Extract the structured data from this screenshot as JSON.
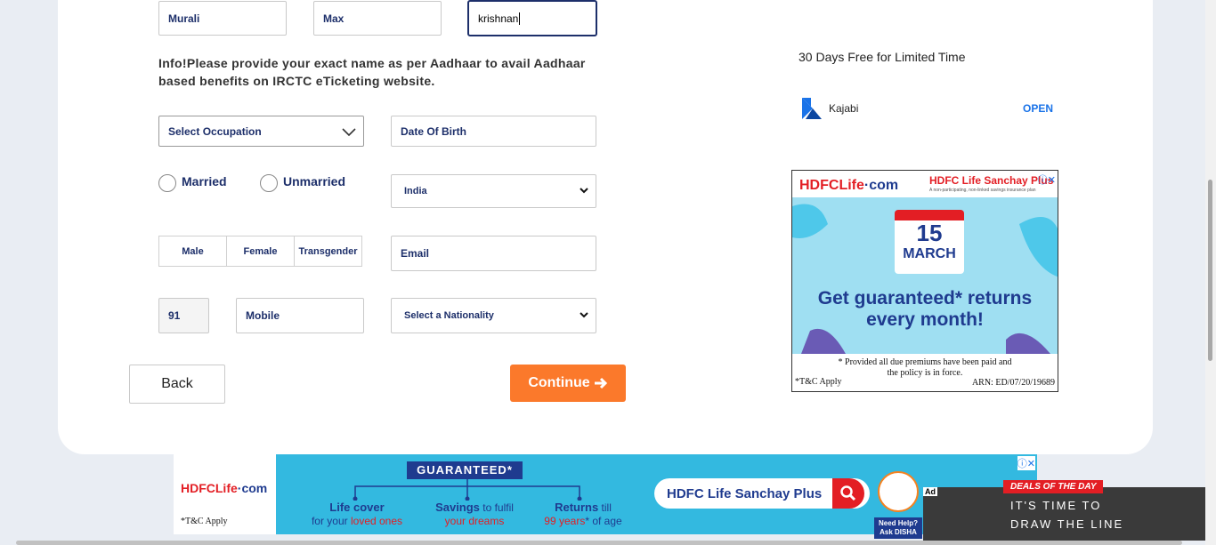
{
  "form": {
    "first_name": "Murali",
    "middle_name": "Max",
    "last_name": "krishnan",
    "info_text": "Info!Please provide your exact name as per Aadhaar to avail Aadhaar based benefits on IRCTC eTicketing website.",
    "occupation_placeholder": "Select Occupation",
    "dob_placeholder": "Date Of Birth",
    "marital": [
      "Married",
      "Unmarried"
    ],
    "country_selected": "India",
    "gender": [
      "Male",
      "Female",
      "Transgender"
    ],
    "email_placeholder": "Email",
    "isd_code": "91",
    "mobile_placeholder": "Mobile",
    "nationality_placeholder": "Select a Nationality",
    "back_label": "Back",
    "continue_label": "Continue"
  },
  "ad_kajabi": {
    "tagline": "30 Days Free for Limited Time",
    "brand": "Kajabi",
    "cta": "OPEN"
  },
  "ad_hdfc_box": {
    "logo_main": "HDFCLife",
    "logo_suffix": "·com",
    "product": "HDFC Life Sanchay Plus",
    "product_sub": "A non-participating, non-linked savings insurance plan",
    "day": "15",
    "month": "MARCH",
    "headline_1": "Get guaranteed* returns",
    "headline_2": "every month!",
    "note_1": "* Provided all due premiums have been paid and",
    "note_2": "the policy is in force.",
    "tc": "*T&C Apply",
    "arn": "ARN: ED/07/20/19689"
  },
  "ad_hdfc_banner": {
    "logo_main": "HDFCLife",
    "logo_suffix": "·com",
    "tc": "*T&C Apply",
    "guaranteed": "GUARANTEED*",
    "col1_title": "Life cover",
    "col1_pre": "for your ",
    "col1_red": "loved ones",
    "col2_title": "Savings",
    "col2_rest": " to fulfil",
    "col2_red": "your dreams",
    "col3_title": "Returns",
    "col3_rest": " till",
    "col3_red": "99 years",
    "col3_post": "* of age",
    "search_text": "HDFC Life Sanchay Plus"
  },
  "ad_deals": {
    "ad_label": "Ad",
    "deal": "DEALS OF THE DAY",
    "line1": "IT'S TIME TO",
    "line2": "DRAW THE LINE"
  },
  "disha": {
    "help": "Need Help? Ask DISHA"
  },
  "colors": {
    "primary": "#1d2f6a",
    "accent": "#fb792b",
    "hdfc_blue": "#1f3b8f",
    "hdfc_red": "#e31e24"
  }
}
